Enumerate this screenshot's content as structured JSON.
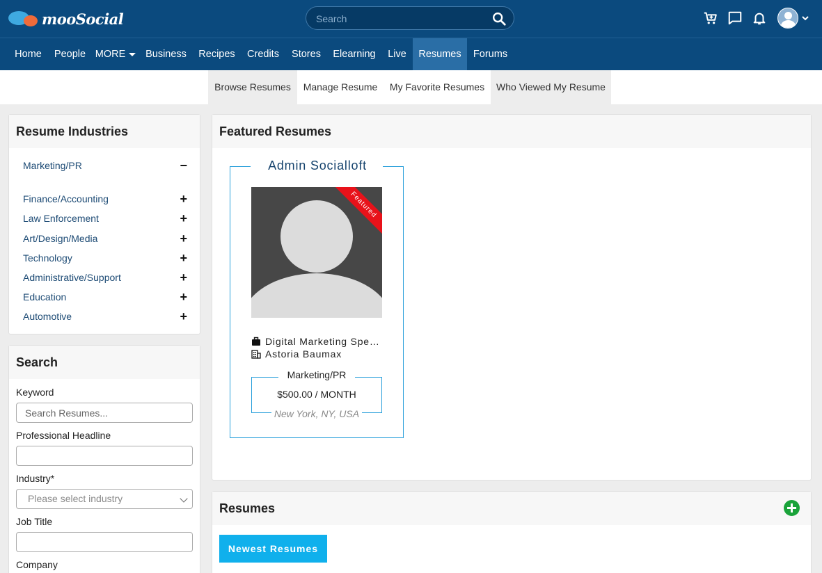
{
  "header": {
    "logo_text": "mooSocial",
    "search_placeholder": "Search",
    "icons": [
      "cart-icon",
      "chat-icon",
      "bell-icon",
      "user-avatar",
      "chevron-down-icon"
    ]
  },
  "nav": {
    "items": [
      "Home",
      "People",
      "MORE",
      "Business",
      "Recipes",
      "Credits",
      "Stores",
      "Elearning",
      "Live",
      "Resumes",
      "Forums"
    ],
    "active": "Resumes"
  },
  "subtabs": [
    "Browse Resumes",
    "Manage Resume",
    "My Favorite Resumes",
    "Who Viewed My Resume"
  ],
  "industries": {
    "title": "Resume Industries",
    "items": [
      {
        "label": "Marketing/PR",
        "sign": "−"
      },
      {
        "label": "Finance/Accounting",
        "sign": "+"
      },
      {
        "label": "Law Enforcement",
        "sign": "+"
      },
      {
        "label": "Art/Design/Media",
        "sign": "+"
      },
      {
        "label": "Technology",
        "sign": "+"
      },
      {
        "label": "Administrative/Support",
        "sign": "+"
      },
      {
        "label": "Education",
        "sign": "+"
      },
      {
        "label": "Automotive",
        "sign": "+"
      }
    ]
  },
  "search": {
    "title": "Search",
    "keyword_label": "Keyword",
    "keyword_placeholder": "Search Resumes...",
    "headline_label": "Professional Headline",
    "industry_label": "Industry*",
    "industry_placeholder": "Please select industry",
    "jobtitle_label": "Job Title",
    "company_label": "Company"
  },
  "featured": {
    "title": "Featured Resumes",
    "resume": {
      "name": "Admin Socialloft",
      "ribbon": "Featured",
      "job": "Digital Marketing Spe…",
      "company": "Astoria Baumax",
      "category": "Marketing/PR",
      "price": "$500.00 / MONTH",
      "location": "New York, NY, USA"
    }
  },
  "resumes": {
    "title": "Resumes",
    "newest_button": "Newest Resumes"
  },
  "colors": {
    "header_bg": "#0b4a7e",
    "active_nav": "#2a6ea6",
    "accent": "#2aa0db",
    "button": "#10b0ec",
    "add": "#1aa33a",
    "ribbon": "#e8121a"
  }
}
